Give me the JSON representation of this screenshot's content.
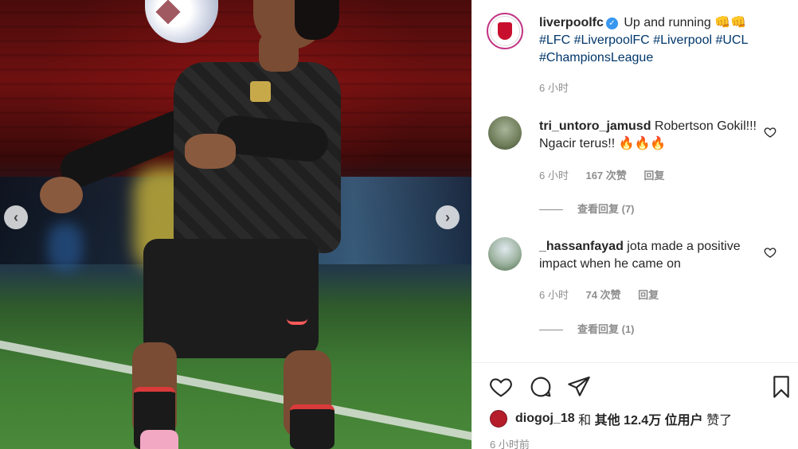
{
  "post": {
    "owner": {
      "username": "liverpoolfc",
      "verified_icon": "verified-badge-icon"
    },
    "caption": {
      "text": "Up and running",
      "hashtags": [
        "#LFC",
        "#LiverpoolFC",
        "#Liverpool",
        "#UCL",
        "#ChampionsLeague"
      ],
      "emoji": "👊👊"
    },
    "caption_time": "6 小时",
    "carousel": {
      "prev_icon": "chevron-left-icon",
      "next_icon": "chevron-right-icon"
    }
  },
  "comments": [
    {
      "username": "tri_untoro_jamusd",
      "text": "Robertson Gokil!!! Ngacir terus!! 🔥🔥🔥",
      "time": "6 小时",
      "likes": "167 次赞",
      "reply": "回复",
      "view_replies": "查看回复 (7)"
    },
    {
      "username": "_hassanfayad",
      "text": "jota made a positive impact when he came on",
      "time": "6 小时",
      "likes": "74 次赞",
      "reply": "回复",
      "view_replies": "查看回复 (1)"
    }
  ],
  "actions": {
    "like_icon": "heart-icon",
    "comment_icon": "comment-icon",
    "share_icon": "paper-plane-icon",
    "save_icon": "bookmark-icon"
  },
  "likes_summary": {
    "liker": "diogoj_18",
    "and": "和",
    "others": "其他 12.4万 位用户",
    "suffix": "赞了"
  },
  "post_time": "6 小时前"
}
